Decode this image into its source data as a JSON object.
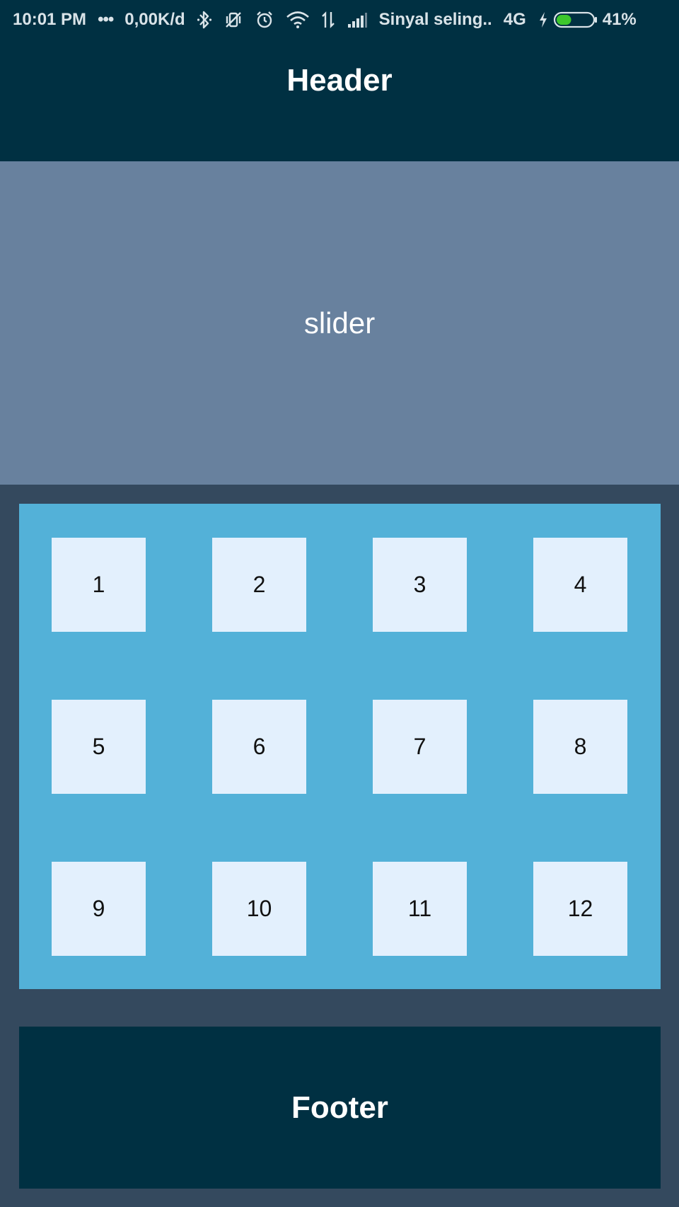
{
  "status_bar": {
    "time": "10:01 PM",
    "more": "•••",
    "speed": "0,00K/d",
    "carrier": "Sinyal seling..",
    "network": "4G",
    "battery_percent": "41%",
    "battery_level": 0.41,
    "icons": [
      "bluetooth-icon",
      "vibrate-off-icon",
      "alarm-icon",
      "wifi-icon",
      "data-arrows-icon",
      "signal-icon",
      "charging-icon",
      "battery-icon"
    ]
  },
  "header": {
    "title": "Header"
  },
  "slider": {
    "label": "slider"
  },
  "grid": {
    "items": [
      {
        "label": "1"
      },
      {
        "label": "2"
      },
      {
        "label": "3"
      },
      {
        "label": "4"
      },
      {
        "label": "5"
      },
      {
        "label": "6"
      },
      {
        "label": "7"
      },
      {
        "label": "8"
      },
      {
        "label": "9"
      },
      {
        "label": "10"
      },
      {
        "label": "11"
      },
      {
        "label": "12"
      }
    ]
  },
  "footer": {
    "title": "Footer"
  },
  "colors": {
    "dark_navy": "#003042",
    "slider_bg": "#68819e",
    "page_bg": "#34495e",
    "grid_bg": "#53b1d8",
    "tile_bg": "#e3f0fd",
    "battery_green": "#3cc72c"
  }
}
